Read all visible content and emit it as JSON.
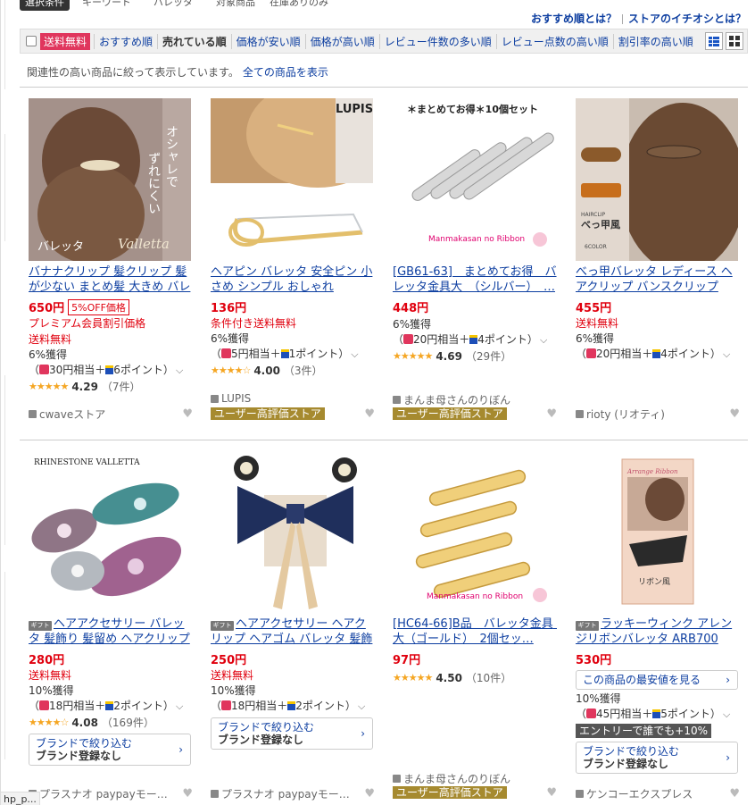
{
  "top": {
    "filter_tag": "選択条件",
    "fragments": [
      "キーワード",
      "バレッタ",
      "対象商品",
      "在庫ありのみ"
    ],
    "links": [
      "おすすめ順とは？",
      "ストアのイチオシとは？"
    ]
  },
  "sortbar": {
    "free_shipping": "送料無料",
    "items": [
      "おすすめ順",
      "売れている順",
      "価格が安い順",
      "価格が高い順",
      "レビュー件数の多い順",
      "レビュー点数の高い順",
      "割引率の高い順"
    ],
    "active_index": 1
  },
  "relevance": {
    "note": "関連性の高い商品に絞って表示しています。",
    "link": "全ての商品を表示"
  },
  "products": [
    {
      "title": "バナナクリップ 髪クリップ 髪が少ない まとめ髪 大きめ バレッタ",
      "image_text": [
        "オシャレで",
        "ずれにくい",
        "バレッタ",
        "Valletta"
      ],
      "price": "650円",
      "badge": "5%OFF価格",
      "red_lines": [
        "プレミアム会員割引価格",
        "送料無料"
      ],
      "points": "6%獲得",
      "points_detail": [
        "（",
        "30円相当＋",
        "6ポイント）"
      ],
      "rating": "4.29",
      "reviews": "（7件）",
      "store": "cwaveストア"
    },
    {
      "title": "ヘアピン バレッタ 安全ピン 小さめ シンプル おしゃれ",
      "image_text": [
        "LUPIS"
      ],
      "price": "136円",
      "red_lines": [
        "条件付き送料無料"
      ],
      "points": "6%獲得",
      "points_detail": [
        "（",
        "5円相当＋",
        "1ポイント）"
      ],
      "rating": "4.00",
      "reviews": "（3件）",
      "store": "LUPIS",
      "store_badge": "ユーザー高評価ストア"
    },
    {
      "title": "[GB61-63]　まとめてお得　バレッタ金具大　（シルバー）　…",
      "image_text": [
        "＊まとめてお得＊10個セット",
        "Manmakasan no Ribbon"
      ],
      "price": "448円",
      "points": "6%獲得",
      "points_detail": [
        "（",
        "20円相当＋",
        "4ポイント）"
      ],
      "rating": "4.69",
      "reviews": "（29件）",
      "store": "まんま母さんのりぼん",
      "store_badge": "ユーザー高評価ストア"
    },
    {
      "title": "べっ甲バレッタ レディース ヘアクリップ バンスクリップ ヘ…",
      "image_text": [
        "HAIRCLIP",
        "べっ甲風",
        "6COLOR"
      ],
      "price": "455円",
      "red_lines": [
        "送料無料"
      ],
      "points": "6%獲得",
      "points_detail": [
        "（",
        "20円相当＋",
        "4ポイント）"
      ],
      "store": "rioty (リオティ)"
    },
    {
      "title": "ヘアアクセサリー バレッタ 髪飾り 髪留め ヘアクリップ ラ…",
      "gift": "ギフト",
      "image_text": [
        "RHINESTONE VALLETTA"
      ],
      "price": "280円",
      "red_lines": [
        "送料無料"
      ],
      "points": "10%獲得",
      "points_detail": [
        "（",
        "18円相当＋",
        "2ポイント）"
      ],
      "rating": "4.08",
      "reviews": "（169件）",
      "brand_l1": "ブランドで絞り込む",
      "brand_l2": "ブランド登録なし",
      "store": "プラスナオ paypayモー…"
    },
    {
      "title": "ヘアアクセサリー ヘアクリップ ヘアゴム バレッタ 髪飾り…",
      "gift": "ギフト",
      "price": "250円",
      "red_lines": [
        "送料無料"
      ],
      "points": "10%獲得",
      "points_detail": [
        "（",
        "18円相当＋",
        "2ポイント）"
      ],
      "brand_l1": "ブランドで絞り込む",
      "brand_l2": "ブランド登録なし",
      "store": "プラスナオ paypayモー…"
    },
    {
      "title": "[HC64-66]B品　バレッタ金具　大（ゴールド）　2個セッ…",
      "image_text": [
        "Manmakasan no Ribbon"
      ],
      "price": "97円",
      "rating": "4.50",
      "reviews": "（10件）",
      "store": "まんま母さんのりぼん",
      "store_badge": "ユーザー高評価ストア"
    },
    {
      "title": "ラッキーウィンク アレンジリボンバレッタ ARB700 (ゆ…",
      "gift": "ギフト",
      "image_text": [
        "Arrange Ribbon",
        "リボン風"
      ],
      "price": "530円",
      "lowest": "この商品の最安値を見る",
      "points": "10%獲得",
      "points_detail": [
        "（",
        "45円相当＋",
        "5ポイント）"
      ],
      "entry": "エントリーで誰でも+10%",
      "brand_l1": "ブランドで絞り込む",
      "brand_l2": "ブランド登録なし",
      "store": "ケンコーエクスプレス"
    }
  ],
  "bottom_tag": "hp_p..."
}
